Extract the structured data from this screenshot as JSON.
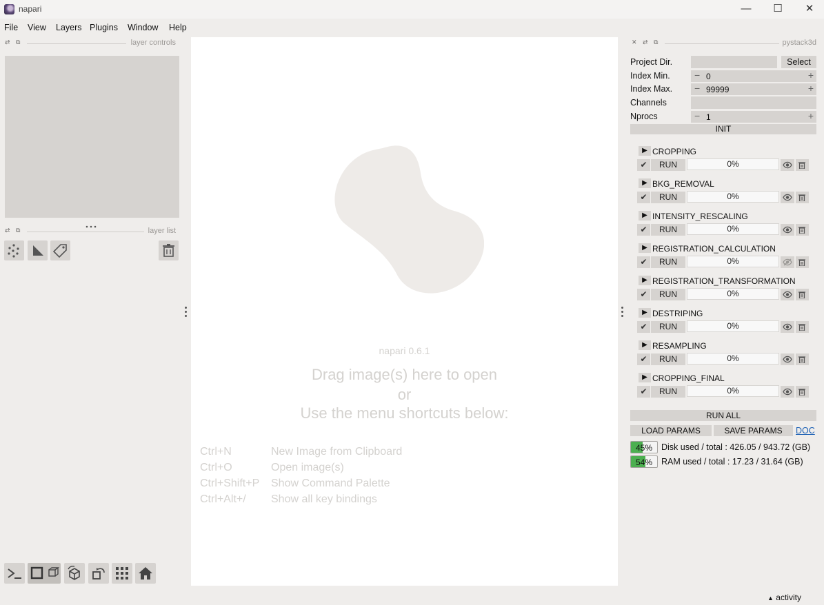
{
  "window": {
    "title": "napari",
    "minimize": "—",
    "maximize": "☐",
    "close": "✕"
  },
  "menu": [
    "File",
    "View",
    "Layers",
    "Plugins",
    "Window",
    "Help"
  ],
  "dock": {
    "layer_controls_title": "layer controls",
    "layer_list_title": "layer list",
    "plugin_title": "pystack3d",
    "ctl_close": "✕",
    "ctl_float": "⧉",
    "ctl_hide": "⇄"
  },
  "layer_tools": [
    "new-points-layer",
    "new-shapes-layer",
    "new-labels-layer",
    "delete-layer"
  ],
  "welcome": {
    "version": "napari 0.6.1",
    "line1": "Drag image(s) here to open",
    "line2": "or",
    "line3": "Use the menu shortcuts below:",
    "shortcuts": [
      {
        "key": "Ctrl+N",
        "desc": "New Image from Clipboard"
      },
      {
        "key": "Ctrl+O",
        "desc": "Open image(s)"
      },
      {
        "key": "Ctrl+Shift+P",
        "desc": "Show Command Palette"
      },
      {
        "key": "Ctrl+Alt+/",
        "desc": "Show all key bindings"
      }
    ]
  },
  "params": {
    "project_dir_label": "Project Dir.",
    "project_dir_value": "",
    "select_label": "Select",
    "index_min_label": "Index Min.",
    "index_min_value": "0",
    "index_max_label": "Index Max.",
    "index_max_value": "99999",
    "channels_label": "Channels",
    "channels_value": "",
    "nprocs_label": "Nprocs",
    "nprocs_value": "1",
    "init_label": "INIT"
  },
  "steps": [
    {
      "name": "CROPPING",
      "run": "RUN",
      "progress": "0%",
      "visible": true
    },
    {
      "name": "BKG_REMOVAL",
      "run": "RUN",
      "progress": "0%",
      "visible": true
    },
    {
      "name": "INTENSITY_RESCALING",
      "run": "RUN",
      "progress": "0%",
      "visible": true
    },
    {
      "name": "REGISTRATION_CALCULATION",
      "run": "RUN",
      "progress": "0%",
      "visible": false
    },
    {
      "name": "REGISTRATION_TRANSFORMATION",
      "run": "RUN",
      "progress": "0%",
      "visible": true
    },
    {
      "name": "DESTRIPING",
      "run": "RUN",
      "progress": "0%",
      "visible": true
    },
    {
      "name": "RESAMPLING",
      "run": "RUN",
      "progress": "0%",
      "visible": true
    },
    {
      "name": "CROPPING_FINAL",
      "run": "RUN",
      "progress": "0%",
      "visible": true
    }
  ],
  "step_arrow": "▶",
  "step_check": "✔",
  "actions": {
    "run_all": "RUN ALL",
    "load_params": "LOAD PARAMS",
    "save_params": "SAVE PARAMS",
    "doc": "DOC"
  },
  "usage": {
    "disk_pct": "45%",
    "disk_fraction": 0.45,
    "disk_text": "Disk used / total : 426.05 / 943.72 (GB)",
    "ram_pct": "54%",
    "ram_fraction": 0.54,
    "ram_text": "RAM used / total : 17.23 / 31.64 (GB)"
  },
  "status": {
    "activity": "activity",
    "activity_arrow": "▲"
  },
  "colors": {
    "accent_green": "#4caf50",
    "link": "#1a5fb4",
    "panel": "#efedeb",
    "widget": "#d6d3d0"
  }
}
